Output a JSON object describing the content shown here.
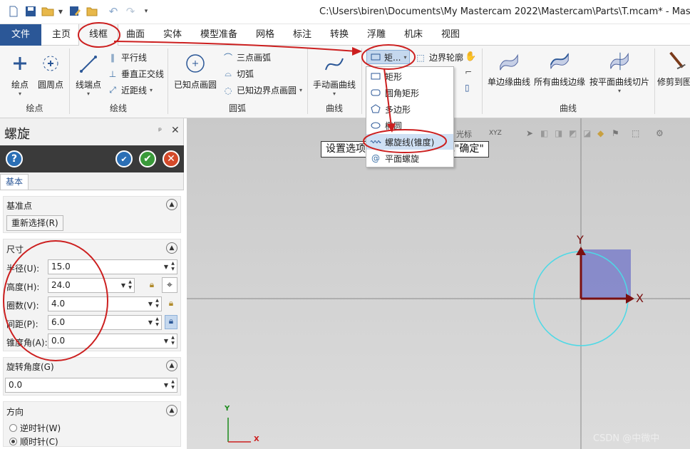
{
  "titlebar": {
    "title": "C:\\Users\\biren\\Documents\\My Mastercam 2022\\Mastercam\\Parts\\T.mcam* - Mastercam",
    "quick_access": [
      "new-file-icon",
      "save-icon",
      "open-folder-icon",
      "save-as-icon",
      "folder-icon",
      "undo-icon",
      "redo-icon",
      "customize-icon"
    ]
  },
  "tabs": [
    "文件",
    "主页",
    "线框",
    "曲面",
    "实体",
    "模型准备",
    "网格",
    "标注",
    "转换",
    "浮雕",
    "机床",
    "视图"
  ],
  "ribbon": {
    "groups": {
      "points": "绘点",
      "lines": "绘线",
      "arcs": "圆弧",
      "spline": "曲线",
      "curves": "曲线"
    },
    "points_buttons": [
      "绘点",
      "圆周点"
    ],
    "line_endpoints": "线端点",
    "line_small": [
      "平行线",
      "垂直正交线",
      "近距线"
    ],
    "arc_known_point": "已知点画圆",
    "arc_small": [
      "三点画弧",
      "切弧",
      "已知边界点画圆"
    ],
    "spline_manual": "手动画曲线",
    "shape_dropdown": "矩...",
    "shape_small": [
      "边界轮廓"
    ],
    "curve_buttons": [
      "单边缘曲线",
      "所有曲线边缘",
      "按平面曲线切片",
      "修剪到图"
    ]
  },
  "shape_menu": [
    "矩形",
    "圆角矩形",
    "多边形",
    "椭圆",
    "螺旋线(锥度)",
    "平面螺旋"
  ],
  "panel": {
    "title": "螺旋",
    "tab": "基本",
    "base_point": {
      "heading": "基准点",
      "reselect": "重新选择(R)"
    },
    "size": {
      "heading": "尺寸",
      "fields": [
        {
          "label": "半径(U):",
          "value": "15.0"
        },
        {
          "label": "高度(H):",
          "value": "24.0"
        },
        {
          "label": "圈数(V):",
          "value": "4.0"
        },
        {
          "label": "间距(P):",
          "value": "6.0"
        },
        {
          "label": "锥度角(A):",
          "value": "0.0"
        }
      ]
    },
    "rotation": {
      "heading": "旋转角度(G)",
      "value": "0.0"
    },
    "direction": {
      "heading": "方向",
      "ccw": "逆时针(W)",
      "cw": "顺时针(C)",
      "selected": "顺时针(C)"
    }
  },
  "viewport": {
    "tooltip": "设置选项，然后选择\"应用\"或\"确定\"",
    "toolbar_label": "光标",
    "axes": {
      "y": "Y",
      "x": "X"
    },
    "small_axes": {
      "y": "Y",
      "x": "X"
    }
  },
  "watermark": "CSDN @中微中",
  "colors": {
    "file_tab": "#2b5797",
    "annotation": "#cc1f1f",
    "circle": "#4dd9e6",
    "axis": "#7a1010",
    "square": "#7b7fc9"
  }
}
